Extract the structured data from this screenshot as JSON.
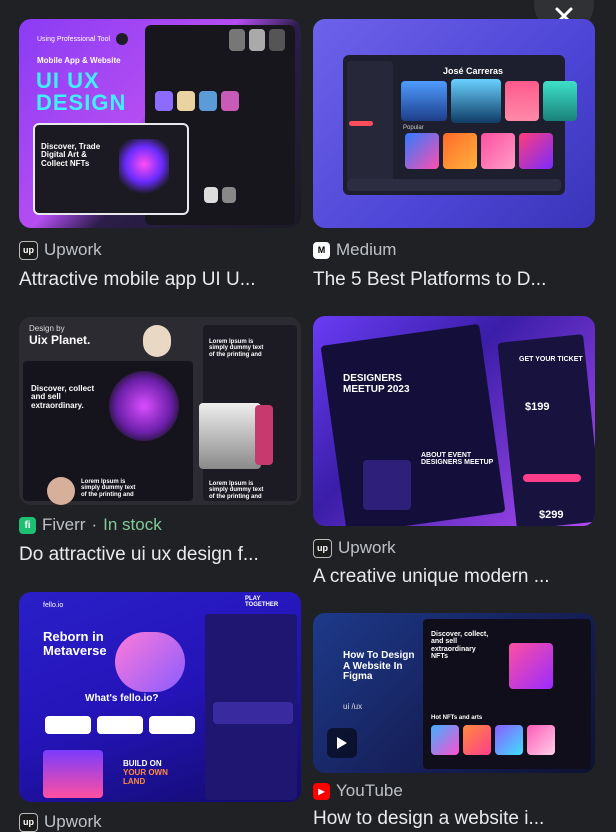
{
  "results": [
    {
      "source": "Upwork",
      "title": "Attractive mobile app UI U...",
      "colors": {
        "bg": "#7b2cf0",
        "accent": "#2ef0ff"
      },
      "thumb_text": {
        "line1": "Using Professional Tool",
        "line2": "Mobile App & Website",
        "big1": "UI UX",
        "big2": "DESIGN",
        "card": "Discover, Trade Digital Art & Collect NFTs"
      },
      "favicon_icon": "upwork-icon"
    },
    {
      "source": "Medium",
      "title": "The 5 Best Platforms to D...",
      "colors": {
        "bg": "#5b54e0",
        "accent": "#ff5a8c"
      },
      "thumb_text": {
        "name": "José Carreras",
        "section": "Popular"
      },
      "favicon_icon": "medium-icon"
    },
    {
      "source": "Fiverr",
      "stock": "In stock",
      "title": "Do attractive ui ux design f...",
      "colors": {
        "bg": "#2a2a30",
        "accent": "#c44dff"
      },
      "thumb_text": {
        "line1": "Design by",
        "line2": "Uix Planet.",
        "hero": "Discover, collect and sell extraordinary.",
        "lorem1": "Lorem Ipsum is simply dummy text of the printing and",
        "lorem2": "Lorem Ipsum is simply dummy text of the printing and",
        "lorem3": "Lorem Ipsum is simply dummy text of the printing and"
      },
      "favicon_icon": "fiverr-icon"
    },
    {
      "source": "Upwork",
      "title": "A creative unique modern ...",
      "colors": {
        "bg": "#3b1fa8",
        "accent": "#ff3d8b"
      },
      "thumb_text": {
        "headline": "DESIGNERS MEETUP 2023",
        "ticket": "GET YOUR TICKET",
        "price1": "$199",
        "price2": "$299",
        "about": "ABOUT EVENT DESIGNERS MEETUP"
      },
      "favicon_icon": "upwork-icon"
    },
    {
      "source": "Upwork",
      "title": "",
      "colors": {
        "bg": "#2414b8",
        "accent": "#ff8a3d"
      },
      "thumb_text": {
        "brand": "fello.io",
        "hero": "Reborn in Metaverse",
        "mid": "What's fello.io?",
        "build1": "BUILD ON",
        "build2": "YOUR OWN",
        "build3": "LAND",
        "play": "PLAY TOGETHER"
      },
      "favicon_icon": "upwork-icon"
    },
    {
      "source": "YouTube",
      "title": "How to design a website i...",
      "colors": {
        "bg": "#1b2a6e",
        "accent": "#c03cff"
      },
      "thumb_text": {
        "howto": "How To Design A Website In Figma",
        "sub": "ui /ux",
        "discover": "Discover, collect, and sell extraordinary NFTs",
        "hot": "Hot NFTs and arts"
      },
      "favicon_icon": "youtube-icon"
    }
  ]
}
